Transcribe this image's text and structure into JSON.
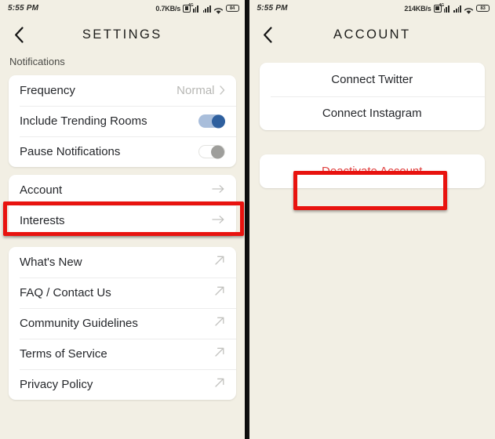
{
  "left_phone": {
    "status_bar": {
      "time": "5:55 PM",
      "data_rate": "0.7KB/s",
      "battery": "84",
      "signal_tag": "4G",
      "icons": [
        "sim-card-icon",
        "signal-bars-icon",
        "signal-bars-icon",
        "wifi-icon",
        "battery-icon"
      ]
    },
    "header": {
      "title": "SETTINGS",
      "back_icon": "chevron-left-icon"
    },
    "section_label": "Notifications",
    "notifications_card": [
      {
        "label": "Frequency",
        "value": "Normal",
        "accessory": "chevron-right-icon"
      },
      {
        "label": "Include Trending Rooms",
        "accessory": "toggle-on"
      },
      {
        "label": "Pause Notifications",
        "accessory": "toggle-off"
      }
    ],
    "account_card": [
      {
        "label": "Account",
        "accessory": "arrow-right-icon",
        "highlighted": true
      },
      {
        "label": "Interests",
        "accessory": "arrow-right-icon"
      }
    ],
    "links_card": [
      {
        "label": "What's New",
        "accessory": "external-link-icon"
      },
      {
        "label": "FAQ / Contact Us",
        "accessory": "external-link-icon"
      },
      {
        "label": "Community Guidelines",
        "accessory": "external-link-icon"
      },
      {
        "label": "Terms of Service",
        "accessory": "external-link-icon"
      },
      {
        "label": "Privacy Policy",
        "accessory": "external-link-icon"
      }
    ]
  },
  "right_phone": {
    "status_bar": {
      "time": "5:55 PM",
      "data_rate": "214KB/s",
      "battery": "83",
      "signal_tag": "4G"
    },
    "header": {
      "title": "ACCOUNT",
      "back_icon": "chevron-left-icon"
    },
    "connect_card": [
      {
        "label": "Connect Twitter"
      },
      {
        "label": "Connect Instagram"
      }
    ],
    "danger_card": [
      {
        "label": "Deactivate Account",
        "highlighted": true
      }
    ]
  },
  "colors": {
    "background": "#f2efe4",
    "card": "#ffffff",
    "text_primary": "#25272b",
    "text_muted": "#b7b7b4",
    "toggle_on": "#2e5f9e",
    "danger": "#e0403f",
    "annotation": "#e8130f"
  }
}
